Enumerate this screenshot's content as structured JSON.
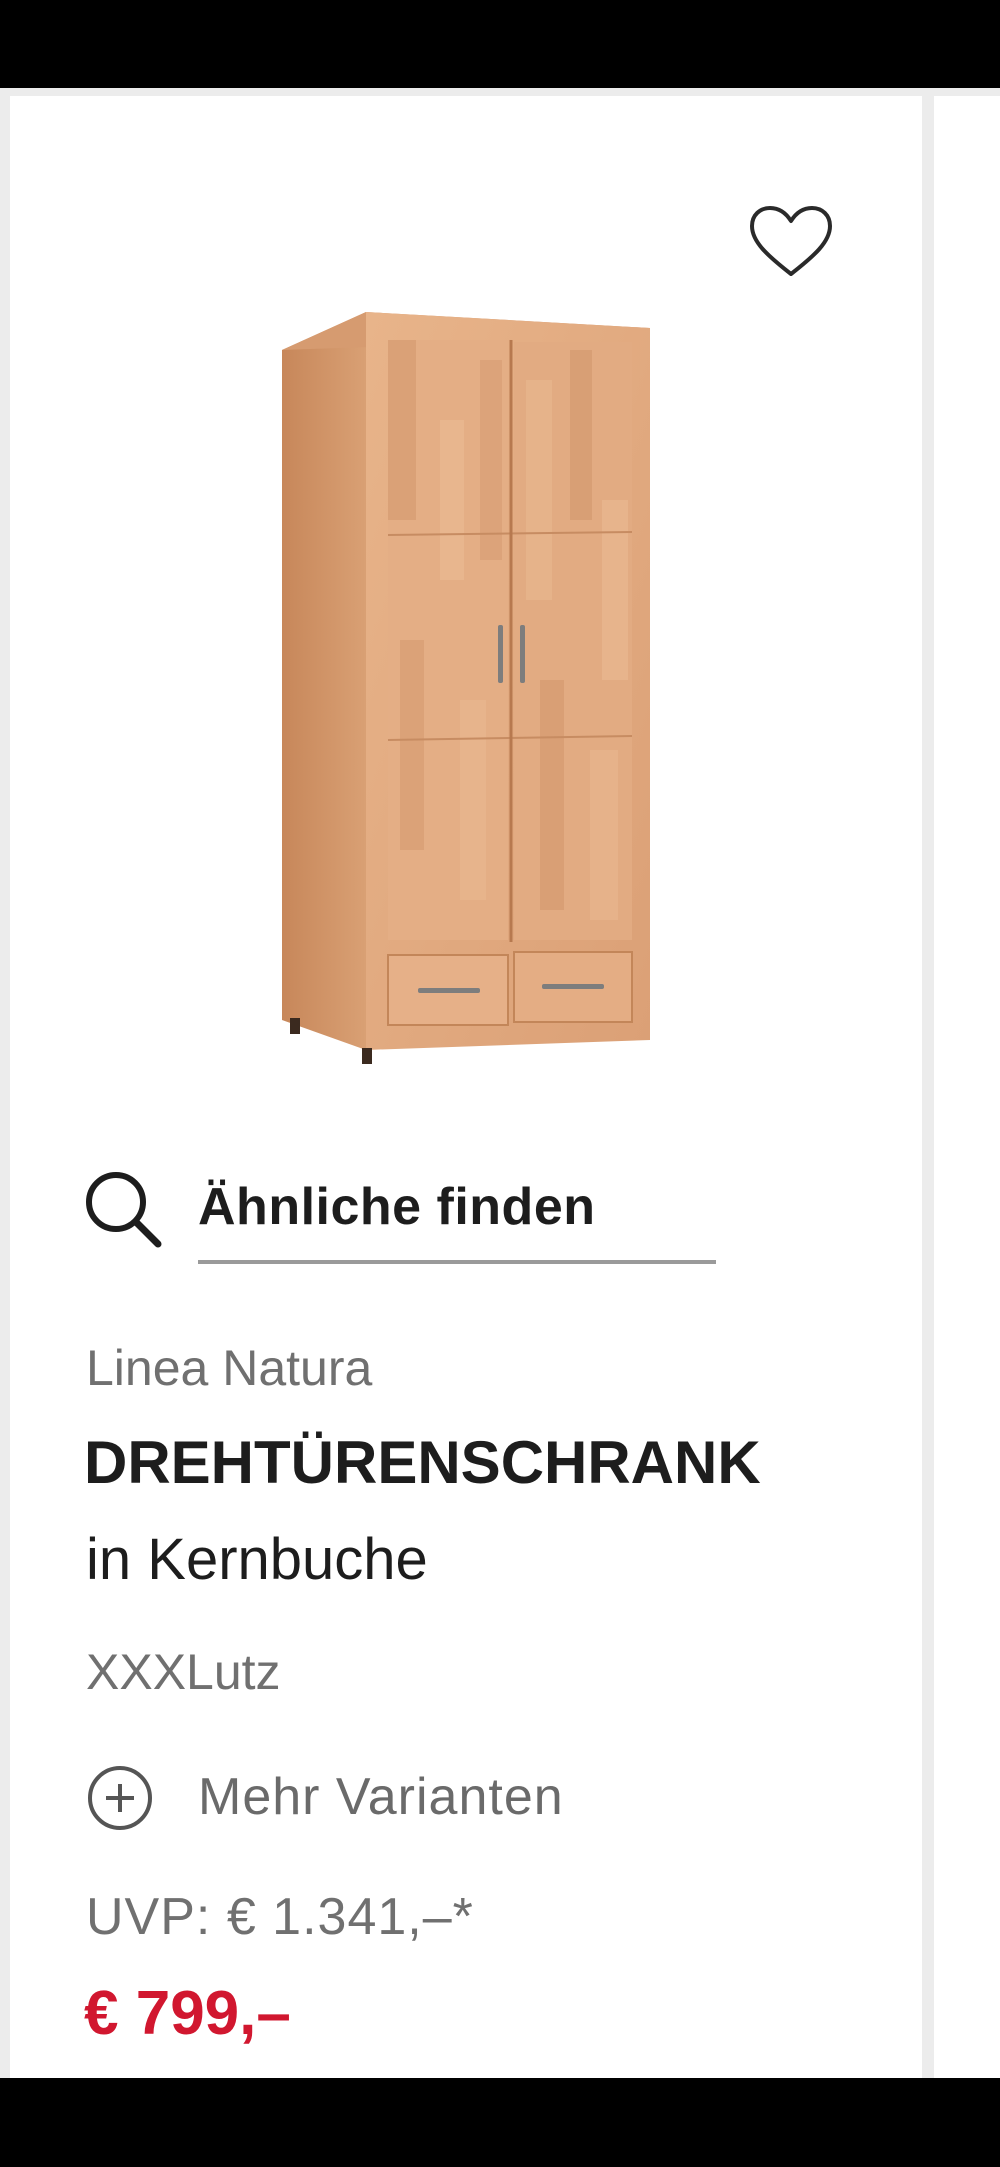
{
  "product": {
    "brand": "Linea Natura",
    "title": "DREHTÜRENSCHRANK",
    "subtitle": "in Kernbuche",
    "seller": "XXXLutz",
    "rrp_price": "UVP: € 1.341,–*",
    "sale_price": "€ 799,–",
    "image_icon": "wardrobe-image"
  },
  "actions": {
    "find_similar_label": "Ähnliche finden",
    "find_similar_icon": "search-icon",
    "more_variants_label": "Mehr Varianten",
    "more_variants_icon": "plus-circle-icon",
    "wishlist_icon": "heart-icon"
  },
  "colors": {
    "sale_price": "#d1172f",
    "text_primary": "#1d1d1d",
    "text_secondary": "#707070",
    "background": "#ececec",
    "card": "#ffffff"
  }
}
